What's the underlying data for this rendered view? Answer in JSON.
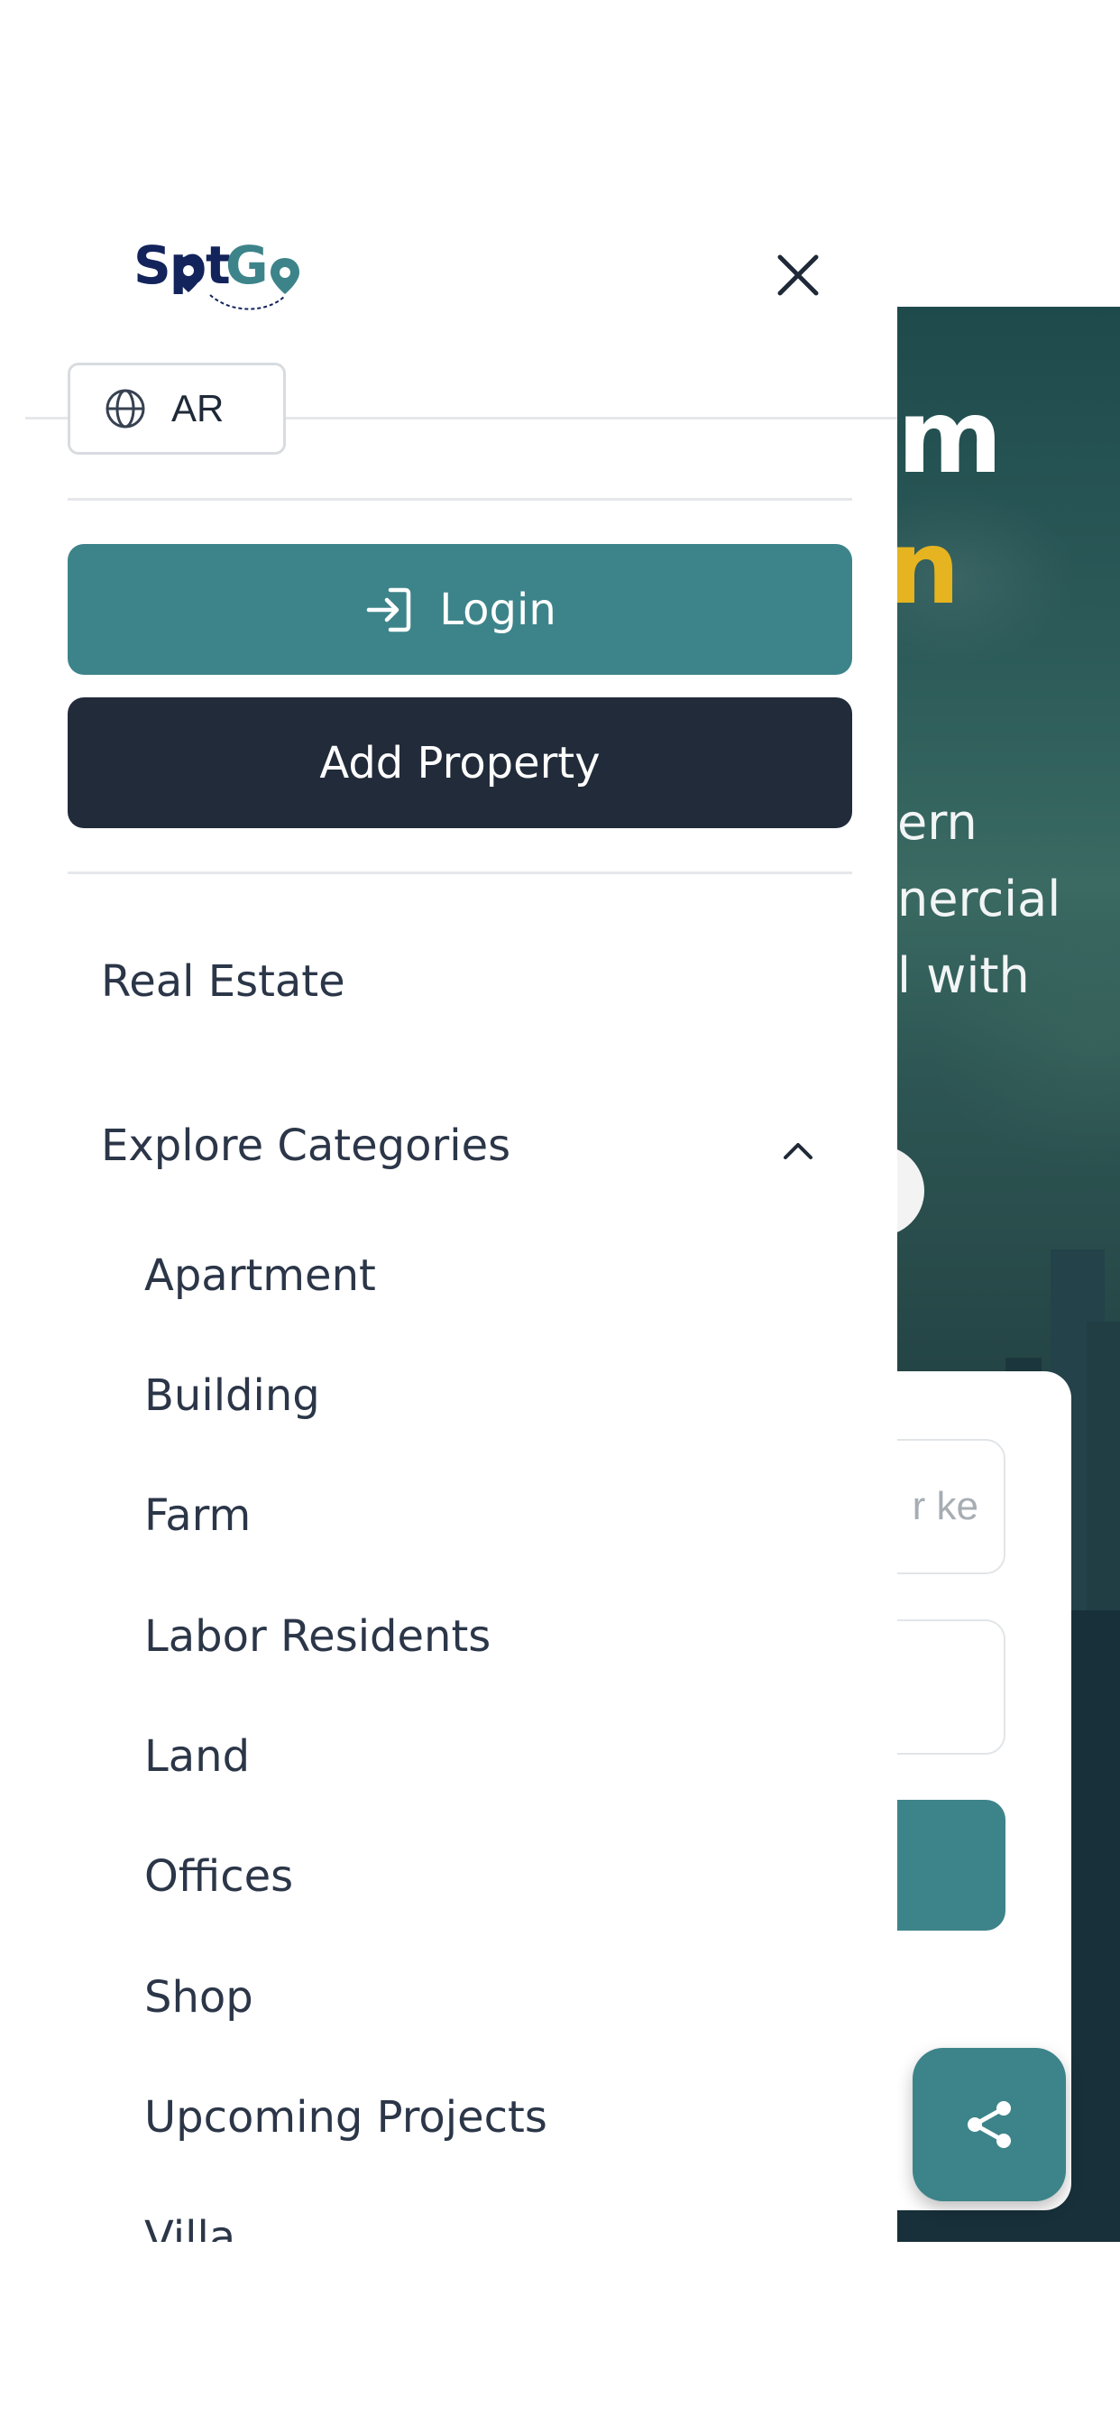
{
  "drawer": {
    "logo": {
      "text_spot": "Spot",
      "text_go": "Go",
      "colors": {
        "spot": "#13235b",
        "go": "#3d848a"
      }
    },
    "close_icon": "close-icon",
    "language_button": {
      "label": "AR",
      "icon": "globe-icon"
    },
    "login_button": {
      "label": "Login",
      "icon": "sign-in-icon"
    },
    "add_property_button": {
      "label": "Add Property"
    },
    "nav": {
      "real_estate": "Real Estate",
      "explore_categories": {
        "label": "Explore Categories",
        "expanded": true,
        "icon": "chevron-up-icon",
        "items": [
          "Apartment",
          "Building",
          "Farm",
          "Labor Residents",
          "Land",
          "Offices",
          "Shop",
          "Upcoming Projects",
          "Villa"
        ]
      }
    }
  },
  "background": {
    "hero_fragments": [
      "m",
      "n",
      "ern",
      "nercial",
      "l with"
    ],
    "search_placeholder_fragment": "r ke",
    "share_icon": "share-icon"
  },
  "colors": {
    "primary": "#3d848a",
    "dark": "#212b3a",
    "text": "#2b3648",
    "accent_gold": "#e6b420"
  }
}
